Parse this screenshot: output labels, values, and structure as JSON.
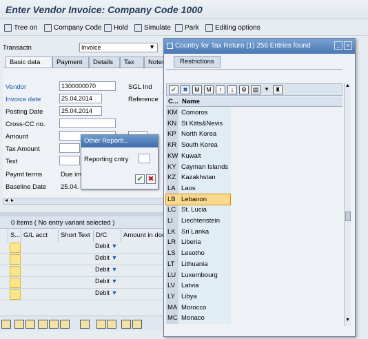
{
  "title": "Enter Vendor Invoice: Company Code 1000",
  "toolbar": {
    "tree_on": "Tree on",
    "company_code": "Company Code",
    "hold": "Hold",
    "simulate": "Simulate",
    "park": "Park",
    "editing_options": "Editing options"
  },
  "transaction": {
    "label": "Transactn",
    "value": "Invoice"
  },
  "tabs": [
    "Basic data",
    "Payment",
    "Details",
    "Tax",
    "Notes"
  ],
  "form": {
    "vendor_label": "Vendor",
    "vendor_value": "1300000070",
    "sgl_label": "SGL Ind",
    "invoice_date_label": "Invoice date",
    "invoice_date_value": "25.04.2014",
    "reference_label": "Reference",
    "posting_date_label": "Posting Date",
    "posting_date_value": "25.04.2014",
    "cross_cc_label": "Cross-CC no.",
    "amount_label": "Amount",
    "tax_amount_label": "Tax Amount",
    "text_label": "Text",
    "paymt_terms_label": "Paymt terms",
    "paymt_terms_value": "Due imm",
    "baseline_label": "Baseline Date",
    "baseline_value": "25.04."
  },
  "items": {
    "header": "0 Items ( No entry variant selected )",
    "columns": [
      "S...",
      "G/L acct",
      "Short Text",
      "D/C",
      "Amount in doc"
    ],
    "dc_value": "Debit"
  },
  "dialog": {
    "title": "Other Reporti...",
    "field_label": "Reporting cntry"
  },
  "country_popup": {
    "title": "Country for Tax Return (1)  256 Entries found",
    "tab": "Restrictions",
    "col_code": "C...",
    "col_name": "Name",
    "selected": "LB",
    "rows": [
      {
        "code": "KM",
        "name": "Comoros"
      },
      {
        "code": "KN",
        "name": "St Kitts&Nevis"
      },
      {
        "code": "KP",
        "name": "North Korea"
      },
      {
        "code": "KR",
        "name": "South Korea"
      },
      {
        "code": "KW",
        "name": "Kuwait"
      },
      {
        "code": "KY",
        "name": "Cayman Islands"
      },
      {
        "code": "KZ",
        "name": "Kazakhstan"
      },
      {
        "code": "LA",
        "name": "Laos"
      },
      {
        "code": "LB",
        "name": "Lebanon"
      },
      {
        "code": "LC",
        "name": "St. Lucia"
      },
      {
        "code": "LI",
        "name": "Liechtenstein"
      },
      {
        "code": "LK",
        "name": "Sri Lanka"
      },
      {
        "code": "LR",
        "name": "Liberia"
      },
      {
        "code": "LS",
        "name": "Lesotho"
      },
      {
        "code": "LT",
        "name": "Lithuania"
      },
      {
        "code": "LU",
        "name": "Luxembourg"
      },
      {
        "code": "LV",
        "name": "Latvia"
      },
      {
        "code": "LY",
        "name": "Libya"
      },
      {
        "code": "MA",
        "name": "Morocco"
      },
      {
        "code": "MC",
        "name": "Monaco"
      }
    ]
  },
  "colors": {
    "accent": "#1b58b2",
    "selected_row": "#f9d98b",
    "title_bar": "#4a77b2"
  }
}
